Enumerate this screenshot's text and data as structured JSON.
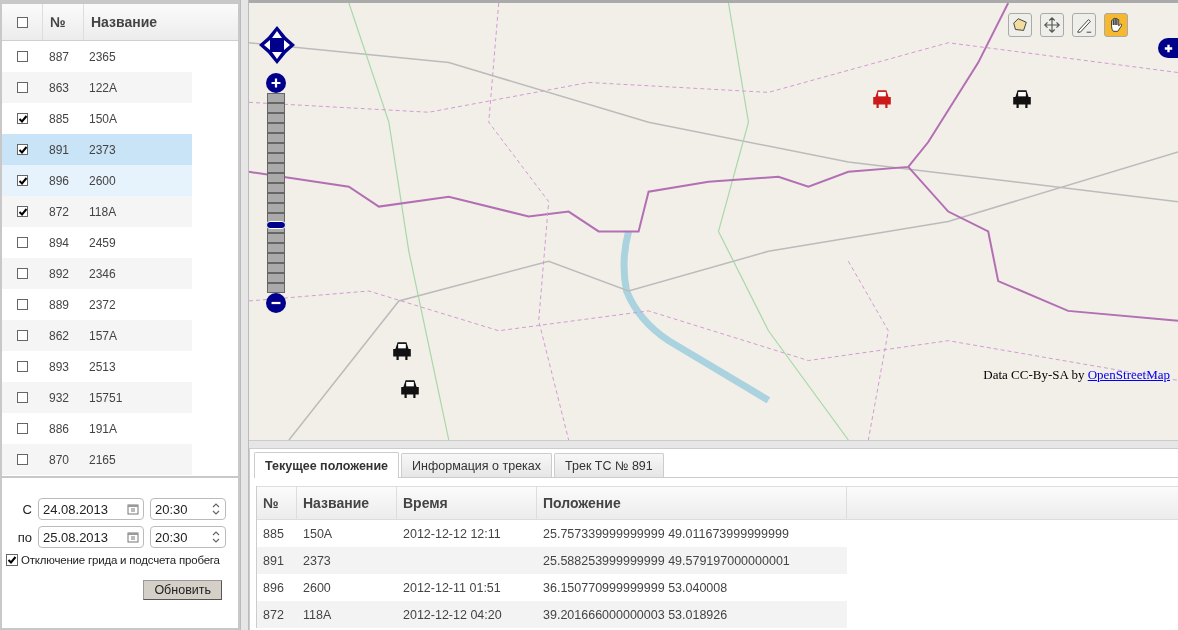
{
  "vehicle_grid": {
    "all_checked": false,
    "columns": [
      "№",
      "Название"
    ],
    "rows": [
      {
        "number": "887",
        "name": "2365",
        "checked": false,
        "selected": false,
        "hovered": false
      },
      {
        "number": "863",
        "name": "122A",
        "checked": false,
        "selected": false,
        "hovered": false
      },
      {
        "number": "885",
        "name": "150A",
        "checked": true,
        "selected": false,
        "hovered": false
      },
      {
        "number": "891",
        "name": "2373",
        "checked": true,
        "selected": true,
        "hovered": false
      },
      {
        "number": "896",
        "name": "2600",
        "checked": true,
        "selected": false,
        "hovered": true
      },
      {
        "number": "872",
        "name": "118A",
        "checked": true,
        "selected": false,
        "hovered": false
      },
      {
        "number": "894",
        "name": "2459",
        "checked": false,
        "selected": false,
        "hovered": false
      },
      {
        "number": "892",
        "name": "2346",
        "checked": false,
        "selected": false,
        "hovered": false
      },
      {
        "number": "889",
        "name": "2372",
        "checked": false,
        "selected": false,
        "hovered": false
      },
      {
        "number": "862",
        "name": "157A",
        "checked": false,
        "selected": false,
        "hovered": false
      },
      {
        "number": "893",
        "name": "2513",
        "checked": false,
        "selected": false,
        "hovered": false
      },
      {
        "number": "932",
        "name": "15751",
        "checked": false,
        "selected": false,
        "hovered": false
      },
      {
        "number": "886",
        "name": "191A",
        "checked": false,
        "selected": false,
        "hovered": false
      },
      {
        "number": "870",
        "name": "2165",
        "checked": false,
        "selected": false,
        "hovered": false
      }
    ]
  },
  "period": {
    "rows": [
      {
        "label": "С",
        "date": "24.08.2013",
        "time": "20:30"
      },
      {
        "label": "по",
        "date": "25.08.2013",
        "time": "20:30"
      }
    ],
    "option": {
      "label": "Отключение грида и подсчета пробега",
      "checked": true
    },
    "refresh_button": "Обновить"
  },
  "map": {
    "zoom": {
      "level": 0.34
    },
    "tools": [
      {
        "kind": "polygon",
        "selected": false
      },
      {
        "kind": "move",
        "selected": false
      },
      {
        "kind": "draw",
        "selected": false
      },
      {
        "kind": "pan",
        "selected": true
      }
    ],
    "markers": [
      {
        "selected": true
      },
      {
        "selected": false
      },
      {
        "selected": false
      },
      {
        "selected": false
      }
    ],
    "attribution": {
      "text": "Data CC-By-SA by",
      "link": "OpenStreetMap"
    }
  },
  "tabs": [
    {
      "label": "Текущее положение",
      "selected": true
    },
    {
      "label": "Информация о треках",
      "selected": false
    },
    {
      "label": "Трек ТС № 891",
      "selected": false
    }
  ],
  "positions": {
    "columns": [
      "№",
      "Название",
      "Время",
      "Положение"
    ],
    "rows": [
      [
        "885",
        "150A",
        "2012-12-12 12:11",
        "25.757339999999999 49.011673999999999"
      ],
      [
        "891",
        "2373",
        "",
        "25.588253999999999 49.579197000000001"
      ],
      [
        "896",
        "2600",
        "2012-12-11 01:51",
        "36.150770999999999 53.040008"
      ],
      [
        "872",
        "118A",
        "2012-12-12 04:20",
        "39.201666000000003 53.018926"
      ]
    ]
  }
}
